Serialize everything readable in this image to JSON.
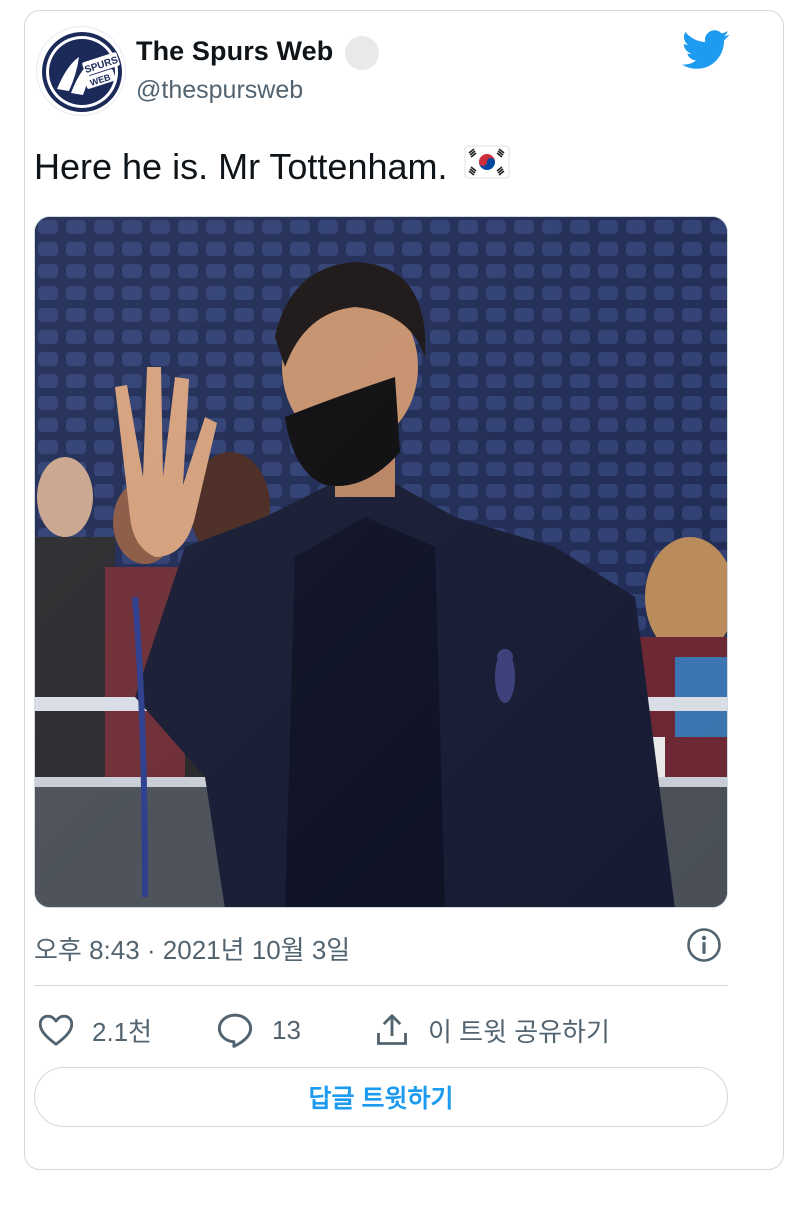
{
  "tweet": {
    "author": {
      "name": "The Spurs Web",
      "handle": "@thespursweb",
      "avatar_logo_text": "SPURS WEB"
    },
    "text": "Here he is. Mr Tottenham.",
    "timestamp": "오후 8:43 · 2021년 10월 3일"
  },
  "actions": {
    "like_count": "2.1천",
    "reply_count": "13",
    "share_label": "이 트윗 공유하기"
  },
  "reply_button": {
    "label": "답글 트윗하기"
  },
  "colors": {
    "accent": "#1d9bf0",
    "text_primary": "#0f1419",
    "text_secondary": "#536471",
    "border": "#cfd9de"
  },
  "icons": {
    "twitter": "twitter-bird-icon",
    "verified": "verified-badge-icon",
    "flag": "south-korea-flag-icon",
    "info": "info-icon",
    "like": "heart-icon",
    "reply": "comment-icon",
    "share": "share-icon"
  }
}
